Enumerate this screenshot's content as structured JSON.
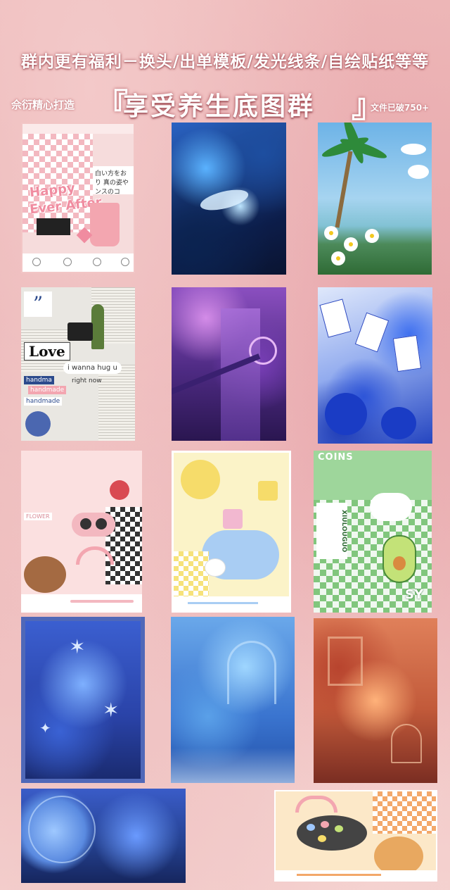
{
  "header": {
    "headline": "群内更有福利－换头/出单模板/发光线条/自绘贴纸等等",
    "maker": "佘衍精心打造",
    "bracket_open": "『",
    "group_title": "享受养生底图群",
    "bracket_close": "』",
    "file_count": "文件已破750+"
  },
  "thumbnails": [
    {
      "id": "pink-happy-ever-after",
      "texts": {
        "line1": "Happy",
        "line2": "Ever After",
        "jp": "白い方をおり 真の姿や ンスのコ"
      }
    },
    {
      "id": "blue-fantasy"
    },
    {
      "id": "palm-trees"
    },
    {
      "id": "newspaper-collage",
      "texts": {
        "love": "Love",
        "hug": "i wanna hug u",
        "right_now": "right now",
        "hm1": "handma",
        "hm2": "handmade",
        "hm3": "handmade"
      }
    },
    {
      "id": "purple-clock-tower"
    },
    {
      "id": "blue-cards"
    },
    {
      "id": "pink-kawaii",
      "texts": {
        "flower": "FLOWER"
      }
    },
    {
      "id": "yellow-puzzle"
    },
    {
      "id": "green-avocado",
      "texts": {
        "coins": "COINS",
        "sy": "SY",
        "side": "XIULOUGUO"
      }
    },
    {
      "id": "blue-framed-castle"
    },
    {
      "id": "blue-cathedral"
    },
    {
      "id": "orange-room"
    },
    {
      "id": "blue-moon"
    },
    {
      "id": "orange-bear"
    }
  ]
}
